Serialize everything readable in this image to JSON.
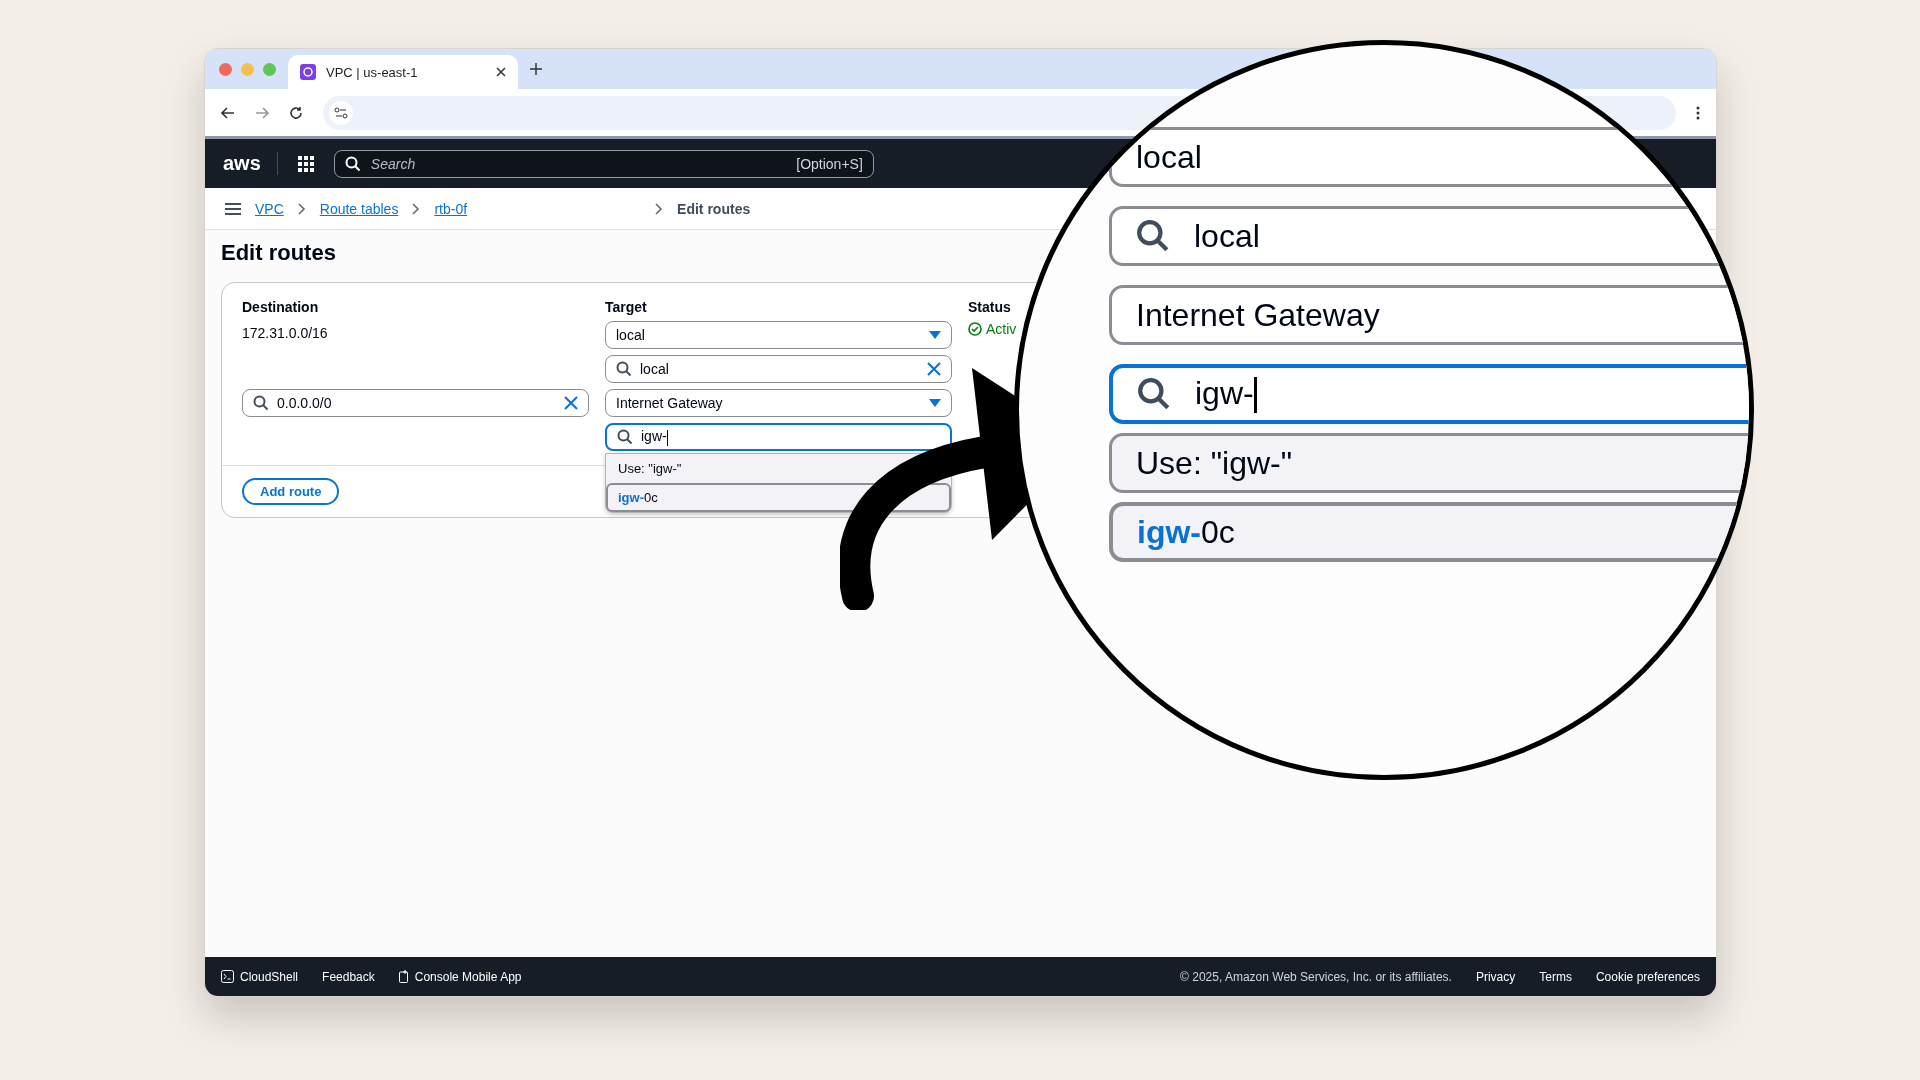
{
  "browser": {
    "tab_title": "VPC | us-east-1"
  },
  "console_header": {
    "logo": "aws",
    "search_placeholder": "Search",
    "shortcut": "[Option+S]"
  },
  "breadcrumbs": [
    {
      "label": "VPC",
      "kind": "link"
    },
    {
      "label": "Route tables",
      "kind": "link"
    },
    {
      "label": "rtb-0f",
      "kind": "link"
    },
    {
      "label": "Edit routes",
      "kind": "current"
    }
  ],
  "page_title": "Edit routes",
  "columns": [
    "Destination",
    "Target",
    "Status"
  ],
  "routes": [
    {
      "destination": "172.31.0.0/16",
      "target": "local",
      "target_search": "local",
      "target_search_focused": false,
      "status": "Activ"
    },
    {
      "destination_search": "0.0.0.0/0",
      "target": "Internet Gateway",
      "target_search": "igw-",
      "target_search_focused": true,
      "options": [
        {
          "text": "Use: \"igw-\"",
          "selected": false
        },
        {
          "text": "**igw-**0c",
          "selected": true
        }
      ]
    }
  ],
  "add_route_button": "Add route",
  "footer": {
    "left": [
      "CloudShell",
      "Feedback",
      "Console Mobile App"
    ],
    "copyright": "© 2025, Amazon Web Services, Inc. or its affiliates.",
    "links": [
      "Privacy",
      "Terms",
      "Cookie preferences"
    ]
  },
  "magnifier": {
    "lines": [
      {
        "kind": "plain",
        "text": "local"
      },
      {
        "kind": "search",
        "text": "local",
        "focused": false
      },
      {
        "kind": "plain",
        "text": "Internet Gateway"
      },
      {
        "kind": "search",
        "text": "igw-",
        "focused": true
      },
      {
        "kind": "option",
        "text": "Use: \"igw-\"",
        "selected": false
      },
      {
        "kind": "option",
        "text": "**igw-**0c",
        "selected": true
      }
    ]
  }
}
